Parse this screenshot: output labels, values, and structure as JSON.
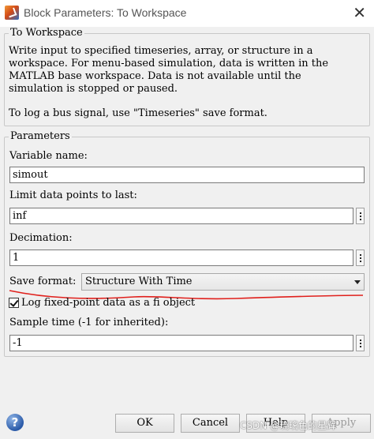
{
  "window": {
    "title": "Block Parameters: To Workspace",
    "close_glyph": "✕"
  },
  "block_group": {
    "title": "To Workspace",
    "description_lines": [
      "Write input to specified timeseries, array, or structure in a",
      "workspace. For menu-based simulation, data is written in the",
      "MATLAB base workspace. Data is not available until the",
      "simulation is stopped or paused."
    ],
    "bus_note": "To log a bus signal, use \"Timeseries\" save format."
  },
  "parameters": {
    "title": "Parameters",
    "variable_name_label": "Variable name:",
    "variable_name_value": "simout",
    "limit_label": "Limit data points to last:",
    "limit_value": "inf",
    "decimation_label": "Decimation:",
    "decimation_value": "1",
    "save_format_label": "Save format:",
    "save_format_value": "Structure With Time",
    "log_fixed_point_label": "Log fixed-point data as a fi object",
    "log_fixed_point_checked": true,
    "sample_time_label": "Sample time (-1 for inherited):",
    "sample_time_value": "-1"
  },
  "buttons": {
    "ok": "OK",
    "cancel": "Cancel",
    "help": "Help",
    "apply": "Apply"
  },
  "icons": {
    "app": "matlab-icon",
    "help": "help-icon"
  },
  "help_glyph": "?",
  "watermark": "CSDN @琉璃色的星辉",
  "colors": {
    "annotation_red": "#e0201c"
  }
}
